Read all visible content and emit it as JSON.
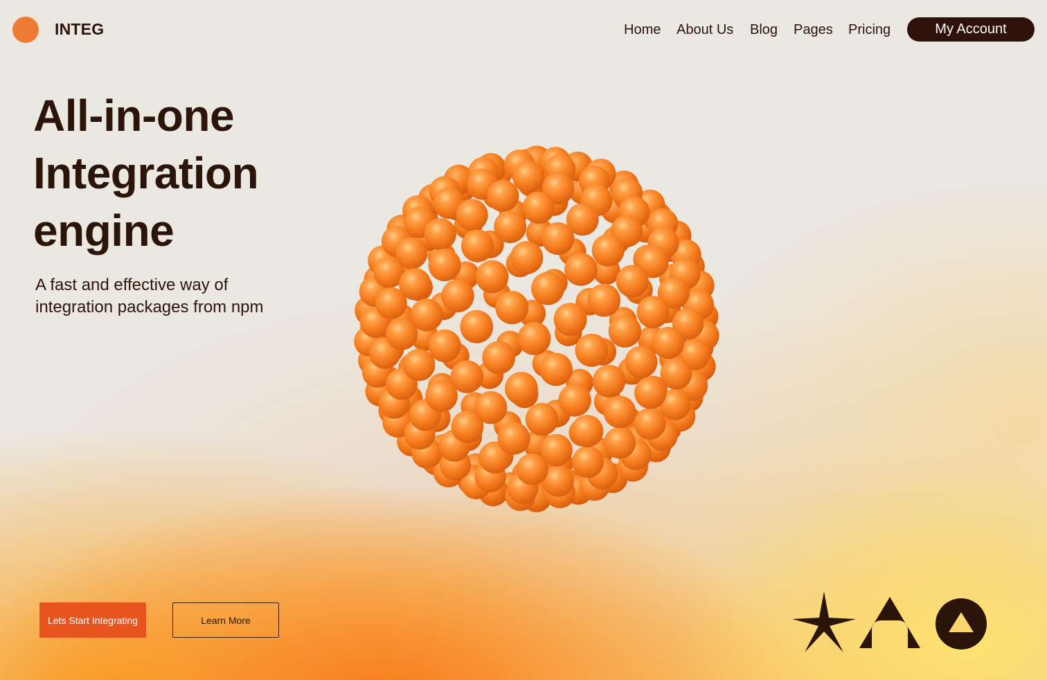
{
  "header": {
    "brand": "INTEG",
    "nav": [
      "Home",
      "About Us",
      "Blog",
      "Pages",
      "Pricing"
    ],
    "account_label": "My Account"
  },
  "hero": {
    "title_lines": [
      "All-in-one",
      "Integration",
      "engine"
    ],
    "subtitle_lines": [
      "A fast and effective way of",
      "integration packages from npm"
    ],
    "primary_cta": "Lets Start Integrating",
    "secondary_cta": "Learn More"
  },
  "icons": [
    "star-icon",
    "arch-icon",
    "circle-triangle-icon"
  ],
  "colors": {
    "brand_orange": "#ee7b33",
    "dark_brown": "#2b140a",
    "cta_orange": "#e8541e",
    "background": "#ebe7e1"
  }
}
